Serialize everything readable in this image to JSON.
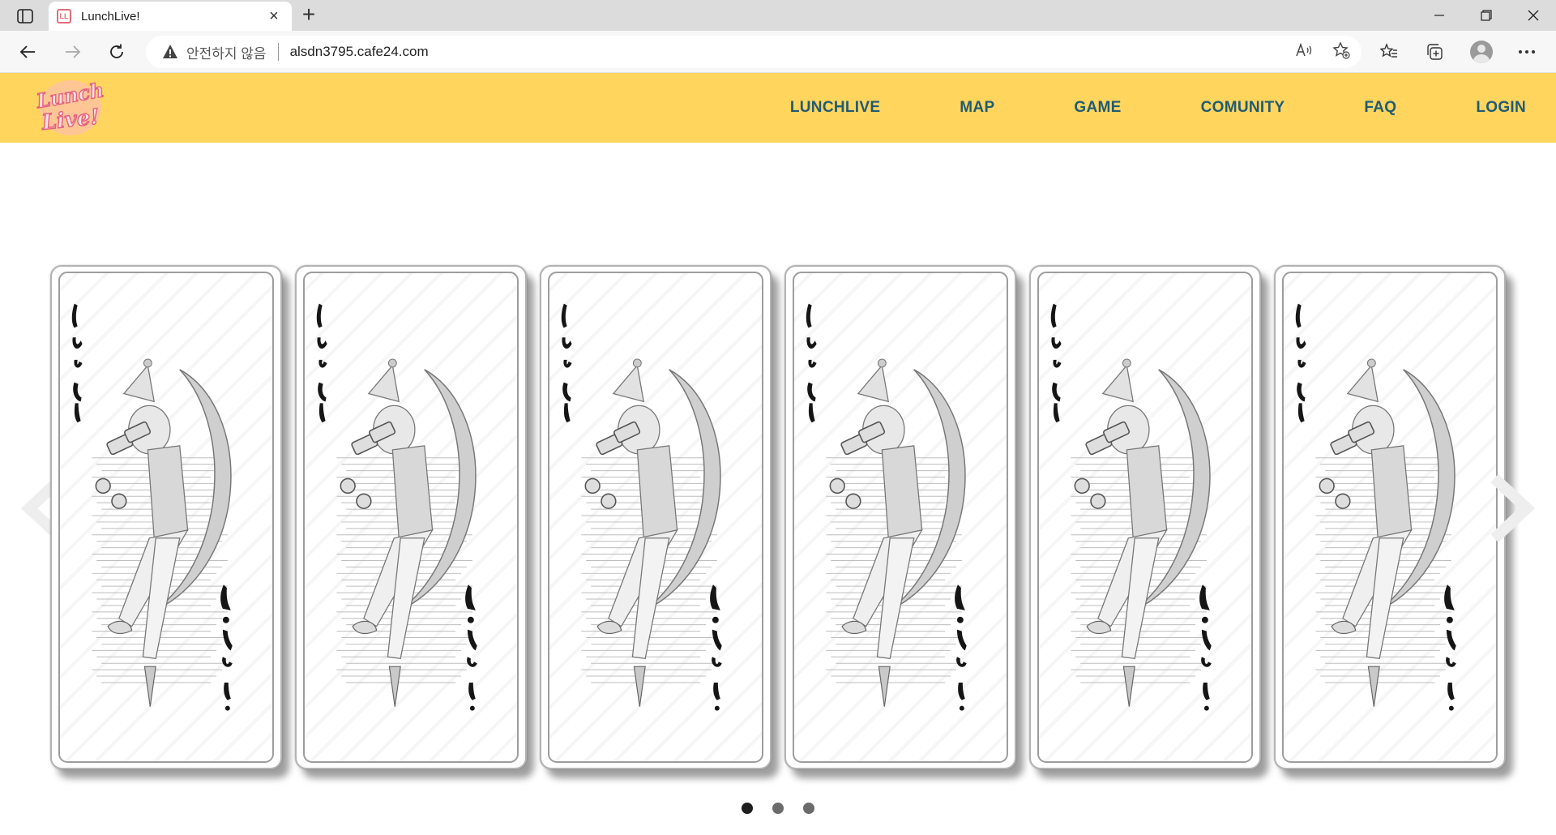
{
  "browser": {
    "tab_title": "LunchLive!",
    "favicon_text": "LL",
    "new_tab_symbol": "+",
    "close_symbol": "×",
    "address": {
      "security_label": "안전하지 않음",
      "url": "alsdn3795.cafe24.com"
    },
    "icons": [
      "sidebar-icon",
      "back-icon",
      "forward-icon",
      "refresh-icon",
      "warning-icon",
      "read-aloud-icon",
      "add-favorite-icon",
      "favorites-icon",
      "collections-icon",
      "profile-icon",
      "more-icon",
      "minimize-icon",
      "restore-icon",
      "close-icon"
    ]
  },
  "site": {
    "logo_text": "Lunch Live!",
    "nav": [
      {
        "label": "LUNCHLIVE"
      },
      {
        "label": "MAP"
      },
      {
        "label": "GAME"
      },
      {
        "label": "COMUNITY"
      },
      {
        "label": "FAQ"
      },
      {
        "label": "LOGIN"
      }
    ],
    "colors": {
      "header_bg": "#ffd55e",
      "nav_text": "#215b72",
      "logo_pink": "#f07890"
    }
  },
  "carousel": {
    "cards": [
      {
        "top_text": "Lunch",
        "bottom_text": "Live!"
      },
      {
        "top_text": "Lunch",
        "bottom_text": "Live!"
      },
      {
        "top_text": "Lunch",
        "bottom_text": "Live!"
      },
      {
        "top_text": "Lunch",
        "bottom_text": "Live!"
      },
      {
        "top_text": "Lunch",
        "bottom_text": "Live!"
      },
      {
        "top_text": "Lunch",
        "bottom_text": "Live!"
      }
    ],
    "active_dot": 0,
    "dot_count": 3
  }
}
